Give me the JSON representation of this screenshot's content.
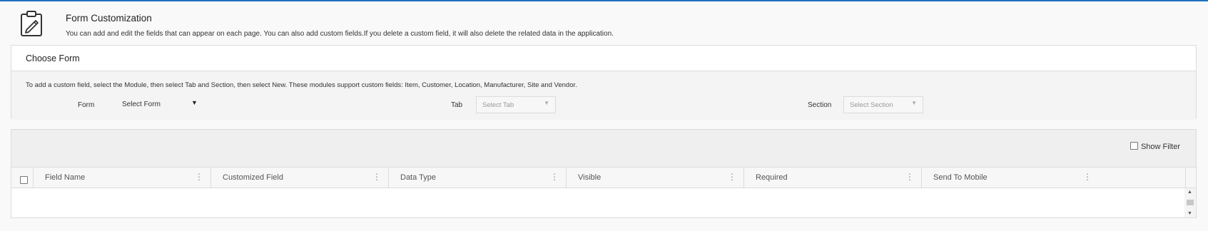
{
  "header": {
    "title": "Form Customization",
    "description": "You can add and edit the fields that can appear on each page. You can also add custom fields.If you delete a custom field, it will also delete the related data in the application.",
    "icon": "clipboard-edit-icon"
  },
  "choose_form": {
    "title": "Choose Form",
    "instructions": "To add a custom field, select the Module, then select Tab and Section, then select New. These modules support custom fields: Item, Customer, Location, Manufacturer, Site and Vendor.",
    "form_label": "Form",
    "form_value": "Select Form",
    "tab_label": "Tab",
    "tab_placeholder": "Select Tab",
    "section_label": "Section",
    "section_placeholder": "Select Section"
  },
  "grid": {
    "show_filter_label": "Show Filter",
    "columns": [
      "Field Name",
      "Customized Field",
      "Data Type",
      "Visible",
      "Required",
      "Send To Mobile"
    ]
  },
  "colors": {
    "accent": "#1f6fbf",
    "border": "#dcdcdc",
    "panel": "#f4f4f4"
  }
}
